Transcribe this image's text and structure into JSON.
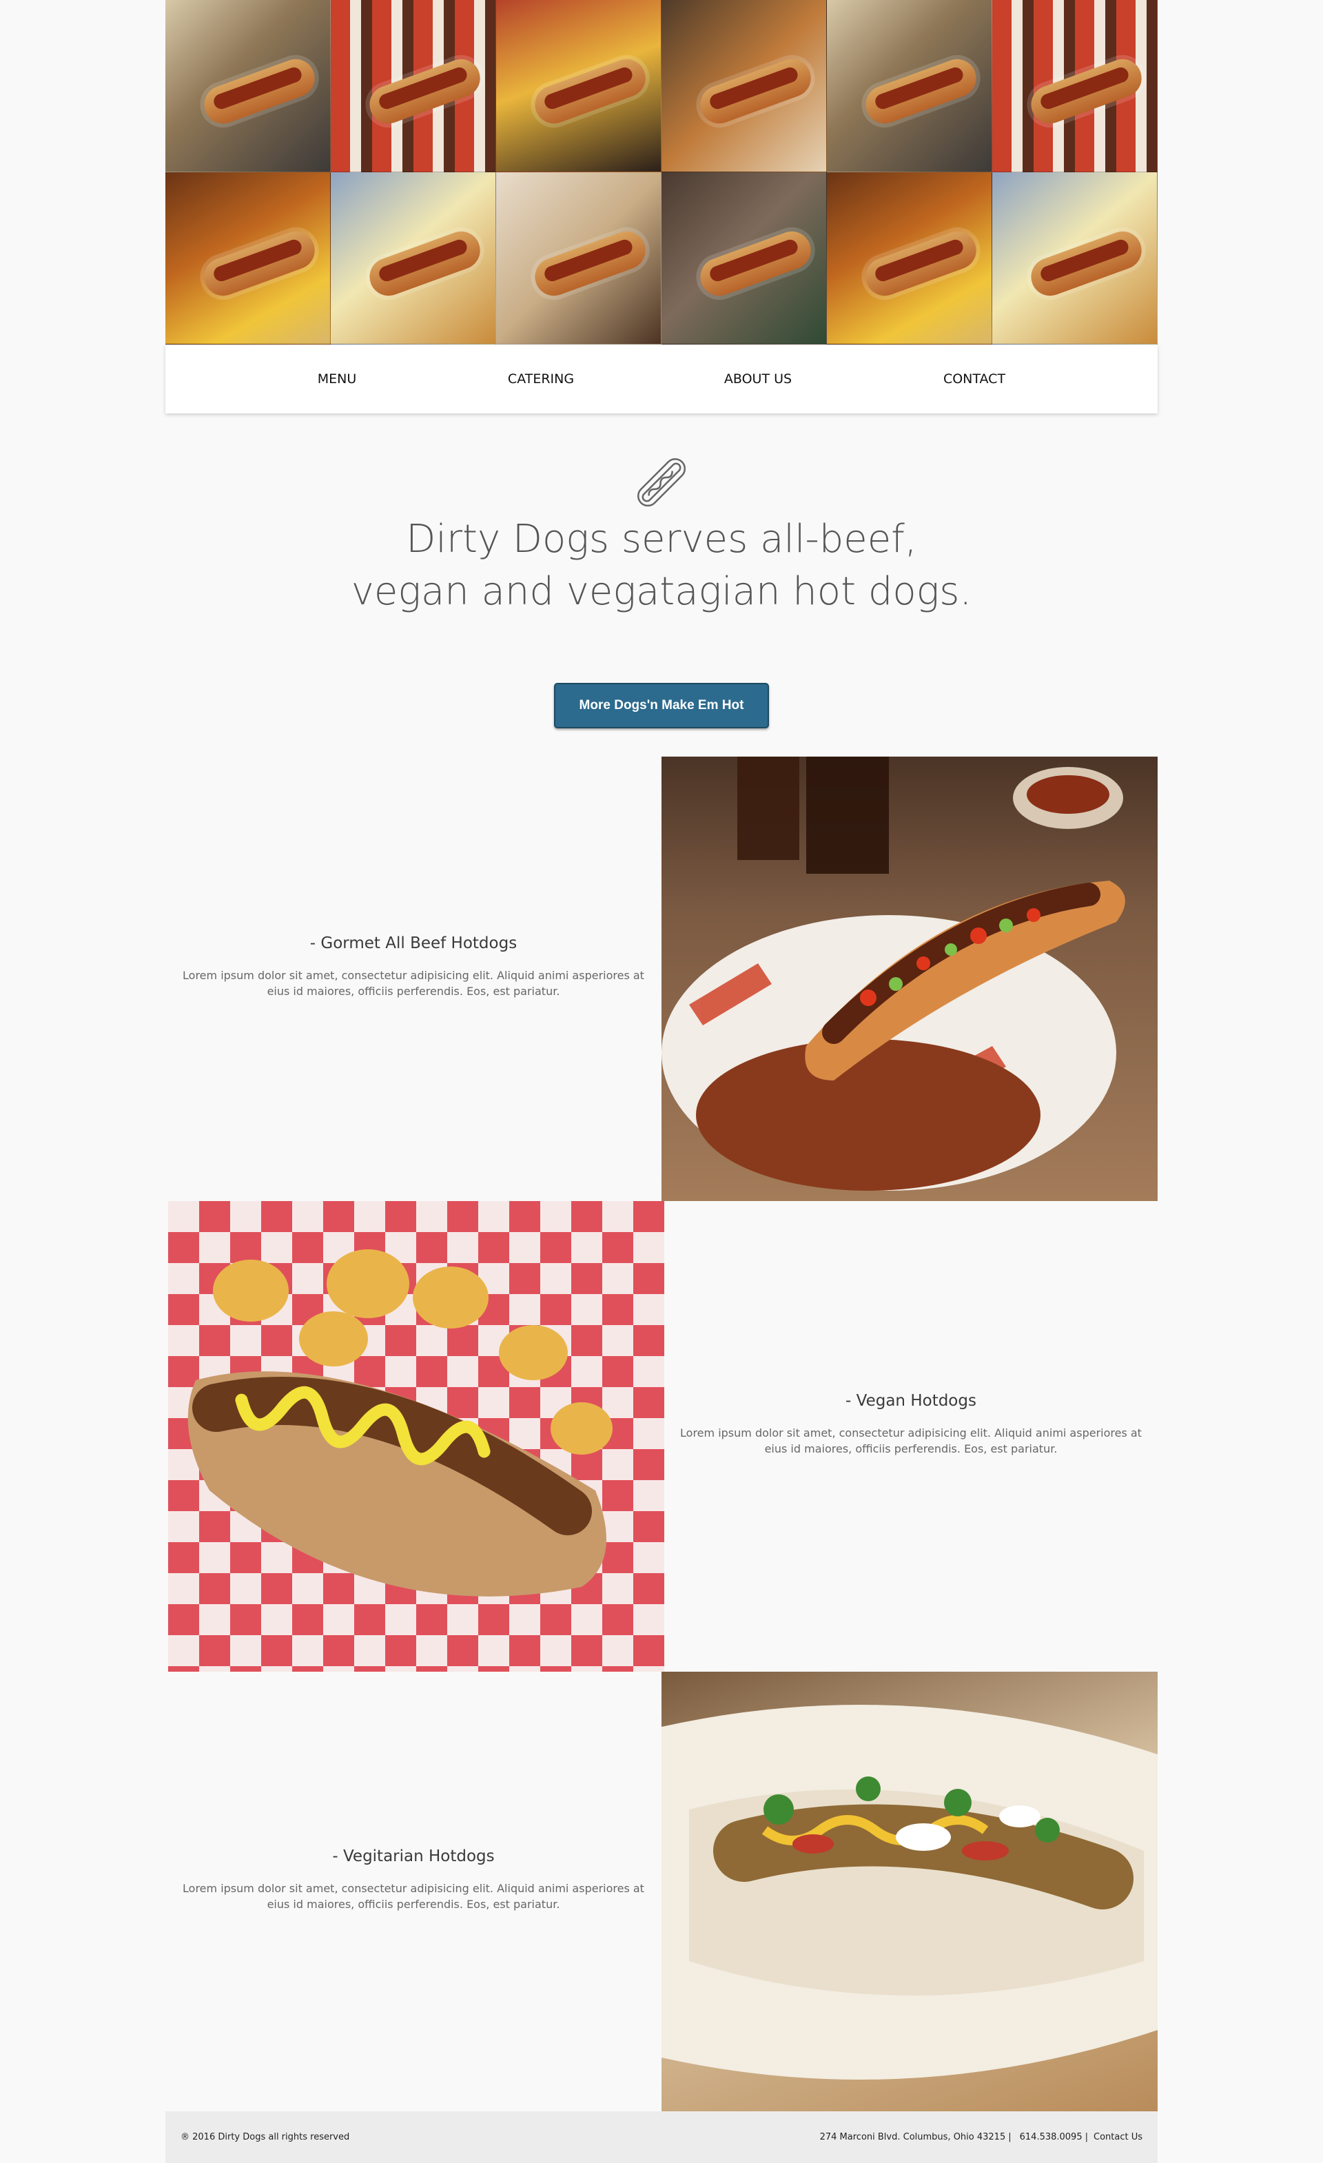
{
  "nav": {
    "items": [
      {
        "label": "MENU"
      },
      {
        "label": "CATERING"
      },
      {
        "label": "ABOUT US"
      },
      {
        "label": "CONTACT"
      }
    ]
  },
  "intro": {
    "icon": "hotdog-outline-icon",
    "headline_line1": "Dirty Dogs serves all-beef,",
    "headline_line2": "vegan and vegatagian hot dogs.",
    "cta_label": "More Dogs'n Make Em Hot"
  },
  "features": [
    {
      "title": "- Gormet All Beef Hotdogs",
      "desc_line1": "Lorem ipsum dolor sit amet, consectetur adipisicing elit. Aliquid animi asperiores at",
      "desc_line2": "eius id maiores, officiis perferendis. Eos, est pariatur."
    },
    {
      "title": "- Vegan Hotdogs",
      "desc_line1": "Lorem ipsum dolor sit amet, consectetur adipisicing elit. Aliquid animi asperiores at",
      "desc_line2": "eius id maiores, officiis perferendis. Eos, est pariatur."
    },
    {
      "title": "- Vegitarian Hotdogs",
      "desc_line1": "Lorem ipsum dolor sit amet, consectetur adipisicing elit. Aliquid animi asperiores at",
      "desc_line2": "eius id maiores, officiis perferendis. Eos, est pariatur."
    }
  ],
  "footer": {
    "copyright": "® 2016 Dirty Dogs all rights reserved",
    "address": "274 Marconi Blvd. Columbus, Ohio 43215",
    "phone": "614.538.0095",
    "contact": "Contact Us"
  },
  "colors": {
    "background": "#f9f9f9",
    "cta": "#2c6a8e",
    "footer": "#ececec"
  }
}
